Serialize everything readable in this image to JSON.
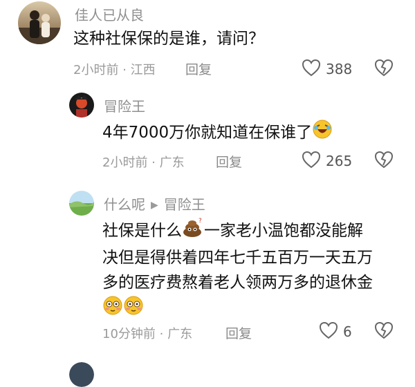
{
  "comments": [
    {
      "name": "佳人已从良",
      "text": "这种社保保的是谁，请问？",
      "time_location": "2小时前 · 江西",
      "reply_label": "回复",
      "likes": "388"
    }
  ],
  "replies": [
    {
      "name": "冒险王",
      "text": "4年7000万你就知道在保谁了",
      "time_location": "2小时前 · 广东",
      "reply_label": "回复",
      "likes": "265"
    },
    {
      "name": "什么呢",
      "reply_to": "冒险王",
      "line1a": "社保是什么",
      "line1b": "一家老小温饱都没能解",
      "line2": "决但是得供着四年七千五百万一天五万",
      "line3": "多的医疗费熬着老人领两万多的退休金",
      "time_location": "10分钟前 · 广东",
      "reply_label": "回复",
      "likes": "6"
    }
  ],
  "icons": {
    "like": "heart-outline-icon",
    "dislike": "broken-heart-icon",
    "reply_arrow": "triangle-right-icon"
  },
  "colors": {
    "meta_gray": "#9a9a9a",
    "name_gray": "#8f8f8f"
  }
}
